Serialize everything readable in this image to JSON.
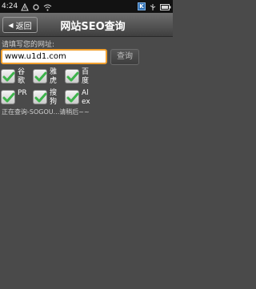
{
  "statusbar": {
    "time": "4:24",
    "icons": [
      "notification-icon",
      "sync-icon",
      "wifi-icon",
      "k-icon",
      "usb-icon",
      "battery-icon"
    ],
    "k_label": "K"
  },
  "header": {
    "back_label": "返回",
    "title": "网站SEO查询"
  },
  "form": {
    "prompt": "请填写您的网址:",
    "url_value": "www.u1d1.com",
    "query_label": "查询"
  },
  "options": [
    {
      "label": "谷歌",
      "checked": true
    },
    {
      "label": "雅虎",
      "checked": true
    },
    {
      "label": "百度",
      "checked": true
    },
    {
      "label": "PR",
      "checked": true
    },
    {
      "label": "搜狗",
      "checked": true
    },
    {
      "label": "Alexa",
      "checked": true
    }
  ],
  "status_message": "正在查询-SOGOU...请稍后~~",
  "colors": {
    "background": "#4a4a4a",
    "input_focus_border": "#f0a030",
    "check_green": "#3cb34a"
  }
}
